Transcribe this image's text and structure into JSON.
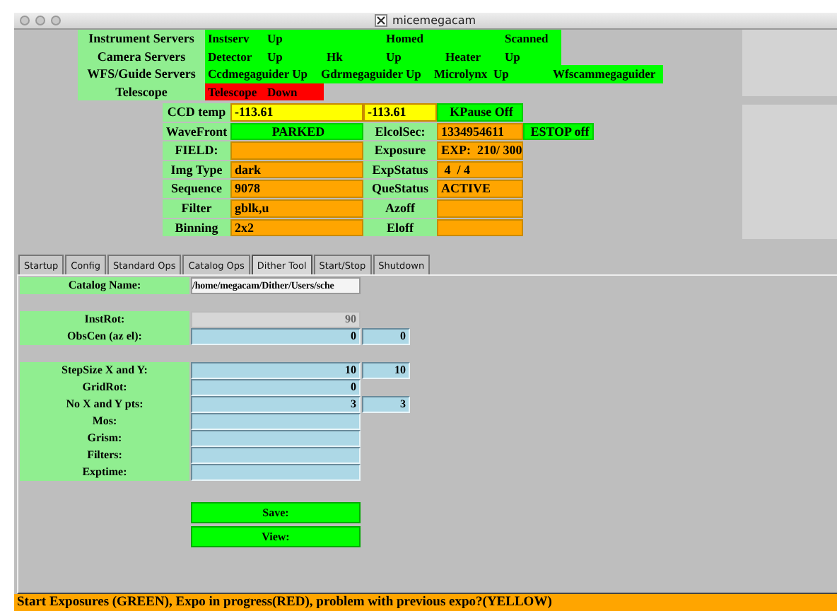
{
  "window": {
    "title": "micemegacam"
  },
  "servers": [
    {
      "label": "Instrument Servers",
      "color": "#00ff00",
      "cells": [
        "Instserv",
        "Up",
        "",
        "Homed",
        "",
        "Scanned"
      ]
    },
    {
      "label": "Camera Servers",
      "color": "#00ff00",
      "cells": [
        "Detector",
        "Up",
        "Hk",
        "Up",
        "Heater",
        "Up"
      ]
    },
    {
      "label": "WFS/Guide Servers",
      "color": "#00ff00",
      "cells": [
        "Ccdmegaguider Up",
        "Gdrmegaguider Up",
        "Microlynx",
        "Up",
        "Wfscammegaguider"
      ]
    },
    {
      "label": "Telescope",
      "color": "#ff0000",
      "cells": [
        "Telescope",
        "Down"
      ]
    }
  ],
  "status": [
    [
      {
        "kind": "label",
        "text": "CCD temp"
      },
      {
        "kind": "value",
        "text": "-113.61",
        "color": "#ffff00"
      },
      {
        "kind": "value",
        "text": "-113.61",
        "color": "#ffff00"
      },
      {
        "kind": "value",
        "text": "KPause Off",
        "color": "#00ff00"
      }
    ],
    [
      {
        "kind": "label",
        "text": "WaveFront"
      },
      {
        "kind": "value",
        "text": "PARKED",
        "color": "#00ff00"
      },
      {
        "kind": "label",
        "text": "ElcolSec:"
      },
      {
        "kind": "value",
        "text": "1334954611",
        "color": "#ffa500"
      },
      {
        "kind": "value",
        "text": "ESTOP off",
        "color": "#00ff00"
      }
    ],
    [
      {
        "kind": "label",
        "text": "FIELD:"
      },
      {
        "kind": "value",
        "color": "#ffa500"
      },
      {
        "kind": "label",
        "text": "Exposure"
      },
      {
        "kind": "value",
        "text": "EXP:  210/ 300",
        "color": "#ffa500"
      }
    ],
    [
      {
        "kind": "label",
        "text": "Img Type"
      },
      {
        "kind": "value",
        "text": "dark",
        "color": "#ffa500"
      },
      {
        "kind": "label",
        "text": "ExpStatus"
      },
      {
        "kind": "value",
        "text": " 4  / 4",
        "color": "#ffa500"
      }
    ],
    [
      {
        "kind": "label",
        "text": "Sequence"
      },
      {
        "kind": "value",
        "text": "9078",
        "color": "#ffa500"
      },
      {
        "kind": "label",
        "text": "QueStatus"
      },
      {
        "kind": "value",
        "text": "ACTIVE",
        "color": "#ffa500"
      }
    ],
    [
      {
        "kind": "label",
        "text": "Filter"
      },
      {
        "kind": "value",
        "text": "gblk,u",
        "color": "#ffa500"
      },
      {
        "kind": "label",
        "text": "Azoff"
      },
      {
        "kind": "value",
        "color": "#ffa500"
      }
    ],
    [
      {
        "kind": "label",
        "text": "Binning"
      },
      {
        "kind": "value",
        "text": "2x2",
        "color": "#ffa500"
      },
      {
        "kind": "label",
        "text": "Eloff"
      },
      {
        "kind": "value",
        "color": "#ffa500"
      }
    ]
  ],
  "tabs": [
    {
      "label": "Startup",
      "selected": false
    },
    {
      "label": "Config",
      "selected": false
    },
    {
      "label": "Standard Ops",
      "selected": false
    },
    {
      "label": "Catalog Ops",
      "selected": false
    },
    {
      "label": "Dither Tool",
      "selected": true
    },
    {
      "label": "Start/Stop",
      "selected": false
    },
    {
      "label": "Shutdown",
      "selected": false
    }
  ],
  "catalog": {
    "label": "Catalog Name:",
    "value": "/home/megacam/Dither/Users/sche"
  },
  "groups": [
    [
      {
        "label": "InstRot:",
        "fields": [
          {
            "value": "90",
            "disabled": true
          }
        ]
      },
      {
        "label": "ObsCen (az el):",
        "fields": [
          {
            "value": "0",
            "disabled": false
          },
          {
            "value": "0",
            "disabled": false
          }
        ]
      }
    ],
    [
      {
        "label": "StepSize X and Y:",
        "fields": [
          {
            "value": "10",
            "disabled": false
          },
          {
            "value": "10",
            "disabled": false
          }
        ]
      },
      {
        "label": "GridRot:",
        "fields": [
          {
            "value": "0",
            "disabled": false
          }
        ]
      },
      {
        "label": "No X and Y pts:",
        "fields": [
          {
            "value": "3",
            "disabled": false
          },
          {
            "value": "3",
            "disabled": false
          }
        ]
      },
      {
        "label": "Mos:",
        "fields": [
          {
            "disabled": false
          }
        ]
      },
      {
        "label": "Grism:",
        "fields": [
          {
            "disabled": false
          }
        ]
      },
      {
        "label": "Filters:",
        "fields": [
          {
            "disabled": false
          }
        ]
      },
      {
        "label": "Exptime:",
        "fields": [
          {
            "disabled": false
          }
        ]
      }
    ]
  ],
  "buttons": [
    "Save:",
    "View:"
  ],
  "status_bar": "Start Exposures (GREEN), Expo in progress(RED), problem with previous expo?(YELLOW)"
}
